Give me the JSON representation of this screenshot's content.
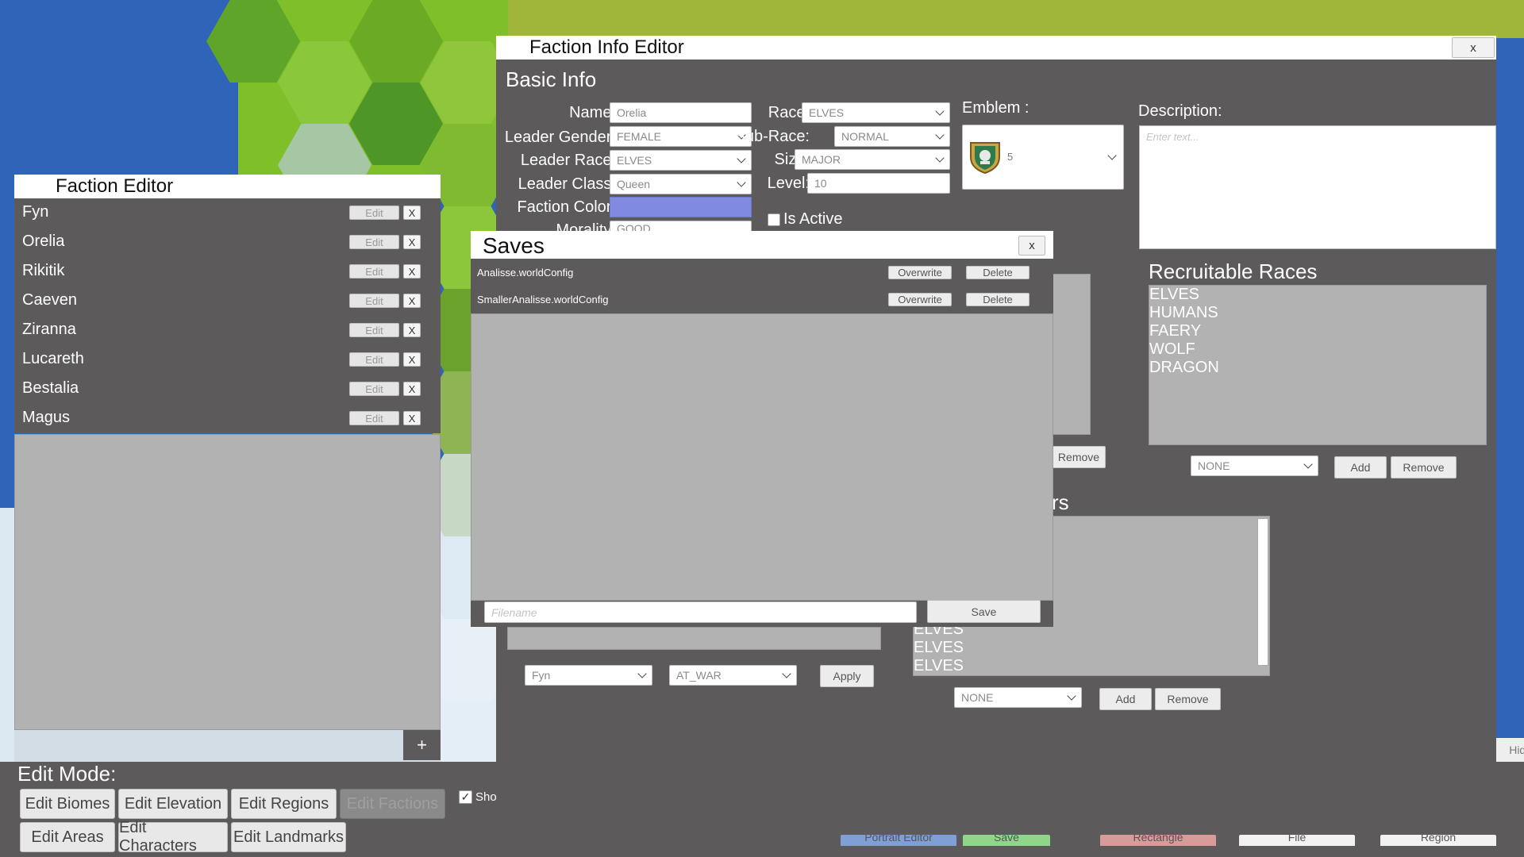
{
  "colors": {
    "panel_bg": "#5c5a5a",
    "list_bg": "#b2b2b2",
    "faction_color": "#7f8ae0",
    "portrait_btn": "#7f9fd6",
    "save_btn": "#8fd68a",
    "rectangle_btn": "#d99a9a"
  },
  "faction_editor": {
    "title": "Faction Editor",
    "edit_label": "Edit",
    "remove_label": "X",
    "add_label": "+",
    "factions": [
      "Fyn",
      "Orelia",
      "Rikitik",
      "Caeven",
      "Ziranna",
      "Lucareth",
      "Bestalia",
      "Magus"
    ]
  },
  "info_editor": {
    "title": "Faction Info Editor",
    "close_label": "x",
    "basic_info_heading": "Basic Info",
    "labels": {
      "name": "Name:",
      "leader_gender": "Leader Gender:",
      "leader_race": "Leader Race:",
      "leader_class": "Leader Class:",
      "faction_color": "Faction Color:",
      "morality": "Morality:",
      "race": "Race:",
      "sub_race": "Sub-Race:",
      "size": "Size:",
      "level": "Level:",
      "emblem": "Emblem :",
      "description": "Description:",
      "is_active": "Is Active"
    },
    "values": {
      "name": "Orelia",
      "leader_gender": "FEMALE",
      "leader_race": "ELVES",
      "leader_class": "Queen",
      "morality": "GOOD",
      "race": "ELVES",
      "sub_race": "NORMAL",
      "size": "MAJOR",
      "level": "10",
      "emblem_value": "5",
      "description_placeholder": "Enter text..."
    },
    "is_active": false,
    "hidden_button_label": "Remove",
    "recruitable_races": {
      "heading": "Recruitable Races",
      "items": [
        "ELVES",
        "HUMANS",
        "FAERY",
        "WOLF",
        "DRAGON"
      ],
      "select_value": "NONE",
      "add_label": "Add",
      "remove_label": "Remove"
    },
    "leaders": {
      "heading_partial": "rs",
      "items": [
        "ELVES",
        "ELVES",
        "ELVES"
      ],
      "select_value": "NONE",
      "add_label": "Add",
      "remove_label": "Remove"
    },
    "relations": {
      "faction_select": "Fyn",
      "state_select": "AT_WAR",
      "apply_label": "Apply"
    }
  },
  "saves": {
    "title": "Saves",
    "close_label": "x",
    "files": [
      "Analisse.worldConfig",
      "SmallerAnalisse.worldConfig"
    ],
    "overwrite_label": "Overwrite",
    "delete_label": "Delete",
    "filename_placeholder": "Filename",
    "save_label": "Save"
  },
  "edit_mode": {
    "label": "Edit Mode:",
    "buttons": [
      "Edit Biomes",
      "Edit Elevation",
      "Edit Regions",
      "Edit Factions",
      "Edit Areas",
      "Edit Characters",
      "Edit Landmarks"
    ],
    "active": "Edit Factions",
    "show_checkbox_label": "Sho",
    "show_checked": true
  },
  "hidden_buttons": {
    "portrait_editor": "Portrait Editor",
    "save": "Save",
    "rectangle": "Rectangle",
    "file": "File",
    "region": "Region",
    "hide": "Hide"
  }
}
